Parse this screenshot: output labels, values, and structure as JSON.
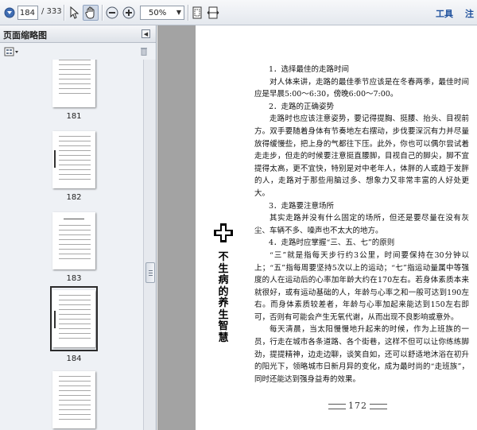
{
  "toolbar": {
    "current_page": "184",
    "page_total": "/ 333",
    "zoom": "50%",
    "tools_label": "工具",
    "comment_label": "注",
    "icons": [
      "save-icon",
      "page-down-icon",
      "select-arrow-icon",
      "hand-icon",
      "zoom-out-icon",
      "zoom-in-icon",
      "fit-page-icon",
      "fit-width-icon"
    ]
  },
  "sidebar": {
    "title": "页面缩略图",
    "thumbnails": [
      {
        "label": "181"
      },
      {
        "label": "182"
      },
      {
        "label": "183"
      },
      {
        "label": "184",
        "selected": true
      }
    ]
  },
  "document": {
    "paragraphs": [
      {
        "style": "h",
        "text": "1．选择最佳的走路时间"
      },
      {
        "style": "ind",
        "text": "对人体来讲，走路的最佳季节应该是在冬春两季，最佳时间应是早晨5:00～6:30，傍晚6:00～7:00。"
      },
      {
        "style": "h",
        "text": "2．走路的正确姿势"
      },
      {
        "style": "ind",
        "text": "走路时也应该注意姿势，要记得提胸、挺腰、抬头、目视前方。双手要随着身体有节奏地左右摆动，步伐要深沉有力并尽量放得缓慢些，把上身的气都往下压。此外，你也可以偶尔尝试着走走步，但走的时候要注意挺直腰脚，目视自己的脚尖，脚不宜提得太高，更不宜快，特别是对中老年人，体胖的人或趋于发胖的人，走路对于那些用脑过多、想象力又非常丰富的人好处更大。"
      },
      {
        "style": "h",
        "text": "3．走路要注意场所"
      },
      {
        "style": "ind",
        "text": "其实走路并没有什么固定的场所，但还是要尽量在没有灰尘、车辆不多、噪声也不太大的地方。"
      },
      {
        "style": "h",
        "text": "4．走路时应掌握“三、五、七”的原则"
      },
      {
        "style": "ind",
        "text": "“三”就是指每天步行约3公里，时间要保持在30分钟以上；“五”指每周要坚持5次以上的运动；“七”指运动量属中等强度的人在运动后的心率加年龄大约在170左右。若身体素质本来就很好，或有运动基础的人，年龄与心率之和一般可达到190左右。而身体素质较差者，年龄与心率加起来能达到150左右即可，否则有可能会产生无氧代谢，从而出现不良影响或意外。"
      },
      {
        "style": "ind",
        "text": "每天清晨，当太阳慢慢地升起来的时候，作为上班族的一员，行走在城市各条道路、各个街巷，这样不但可以让你练练脚劲，提提精神，边走边聊，谈笑自如，还可以舒适地沐浴在初升的阳光下，领略城市日新月异的变化，成为最时尚的“走班族”，同时还能达到强身益寿的效果。"
      }
    ],
    "side_title": "不生病的养生智慧",
    "page_number": "172"
  },
  "colors": {
    "toolbar_bg": "#e4e8ee",
    "sidebar_bg": "#eef1f5",
    "canvas_bg": "#a3a3a3",
    "link": "#1d4f9c"
  }
}
